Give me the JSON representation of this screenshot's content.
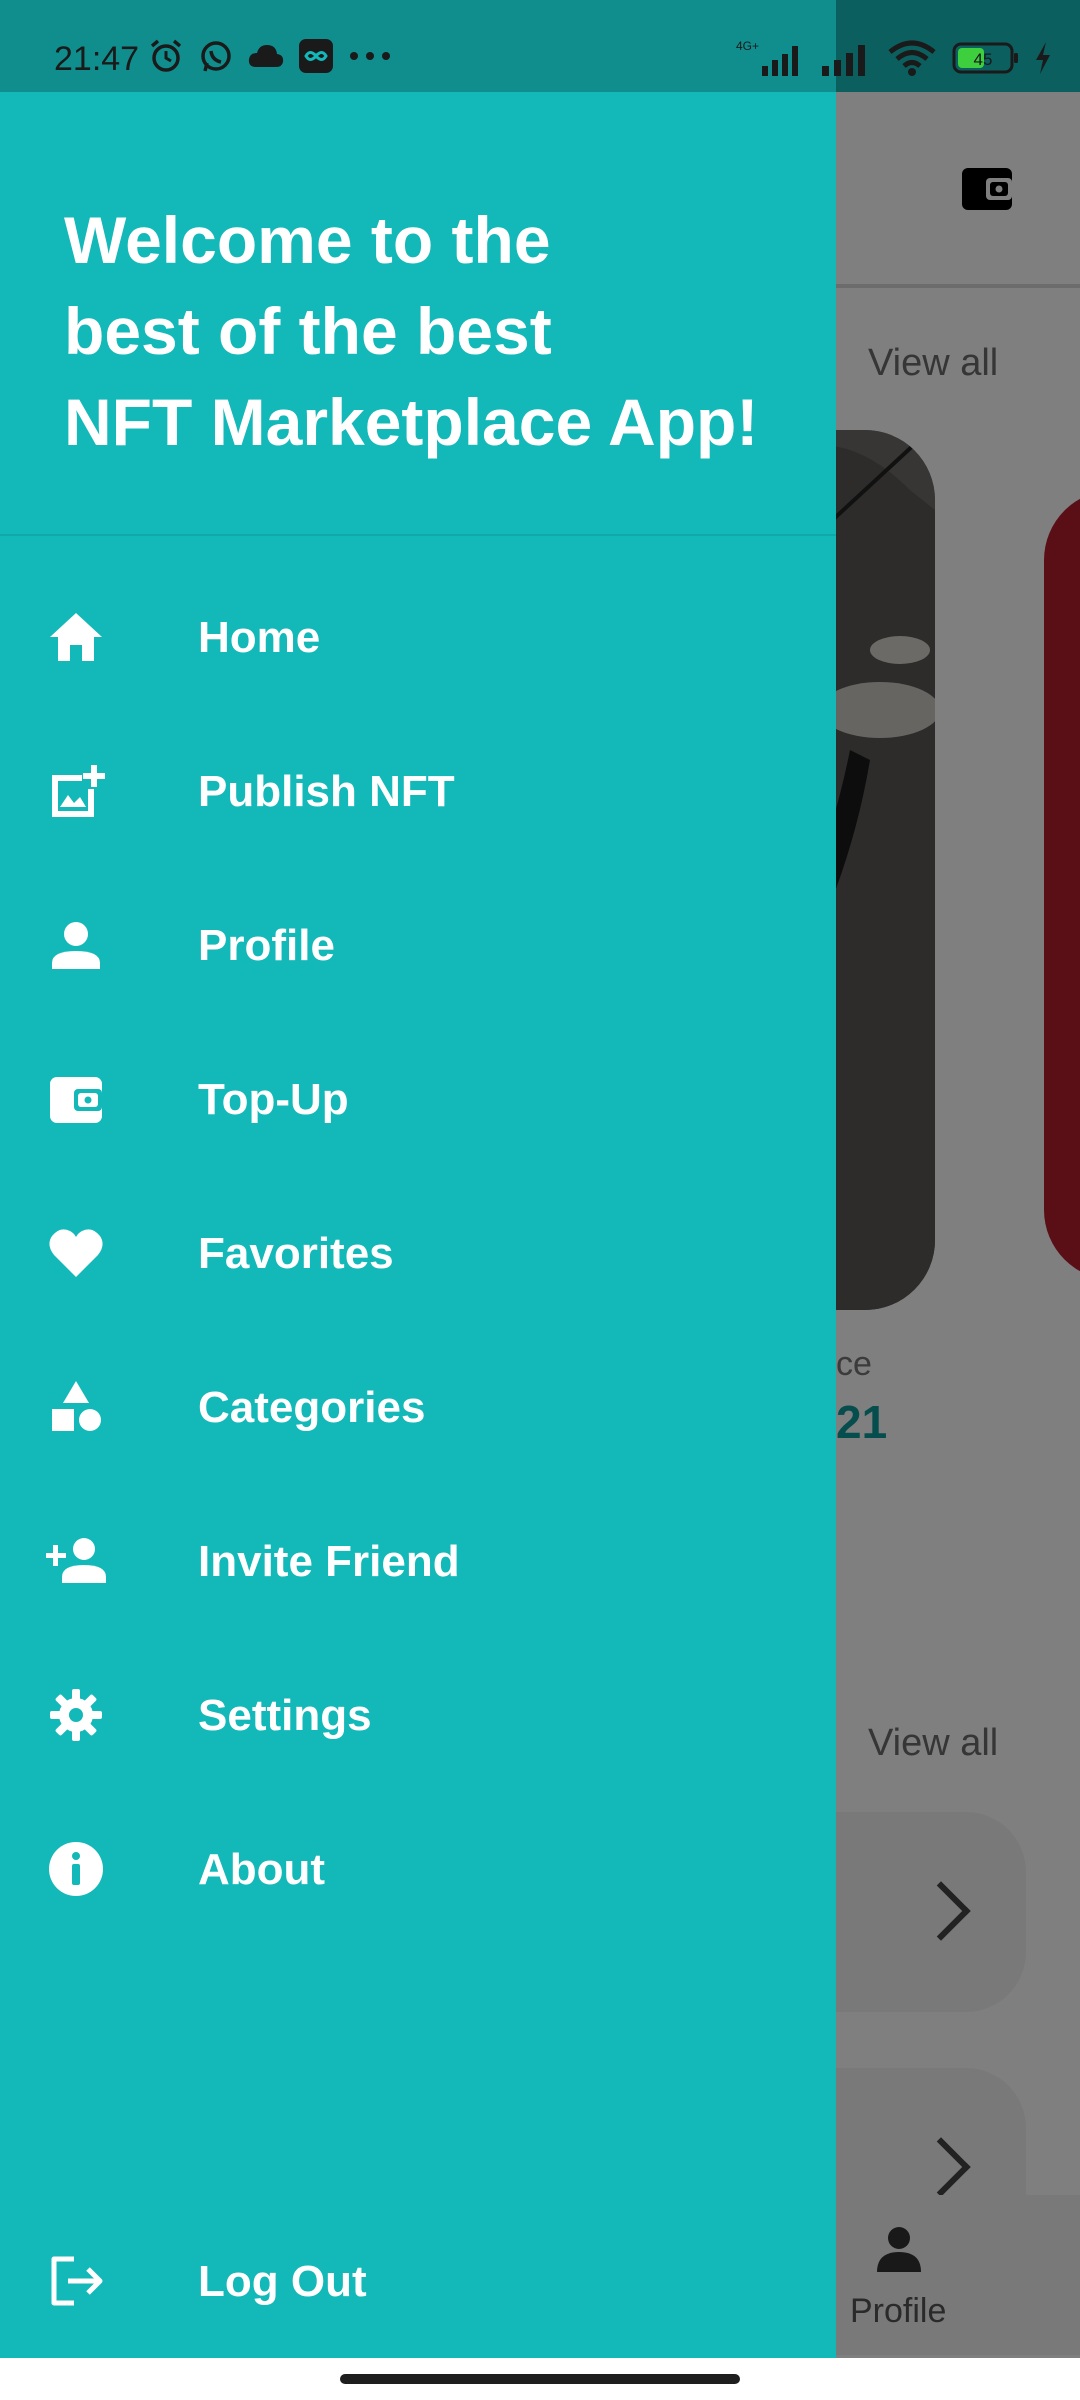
{
  "status_bar": {
    "time": "21:47",
    "network_label": "4G+",
    "battery_level": "45"
  },
  "drawer": {
    "headline": [
      "Welcome to the",
      "best of the best",
      "NFT Marketplace App!"
    ],
    "menu": [
      {
        "label": "Home",
        "icon": "home-icon"
      },
      {
        "label": "Publish NFT",
        "icon": "add-photo-icon"
      },
      {
        "label": "Profile",
        "icon": "person-icon"
      },
      {
        "label": "Top-Up",
        "icon": "wallet-icon"
      },
      {
        "label": "Favorites",
        "icon": "heart-icon"
      },
      {
        "label": "Categories",
        "icon": "shapes-icon"
      },
      {
        "label": "Invite Friend",
        "icon": "person-add-icon"
      },
      {
        "label": "Settings",
        "icon": "gear-icon"
      },
      {
        "label": "About",
        "icon": "info-icon"
      }
    ],
    "logout_label": "Log Out"
  },
  "background": {
    "view_all_1": "View all",
    "view_all_2": "View all",
    "price_label_fragment": "ce",
    "price_value_fragment": "21",
    "bottom_nav_label": "Profile"
  },
  "colors": {
    "drawer_bg": "#13b8b8",
    "accent": "#0d9a9a"
  }
}
